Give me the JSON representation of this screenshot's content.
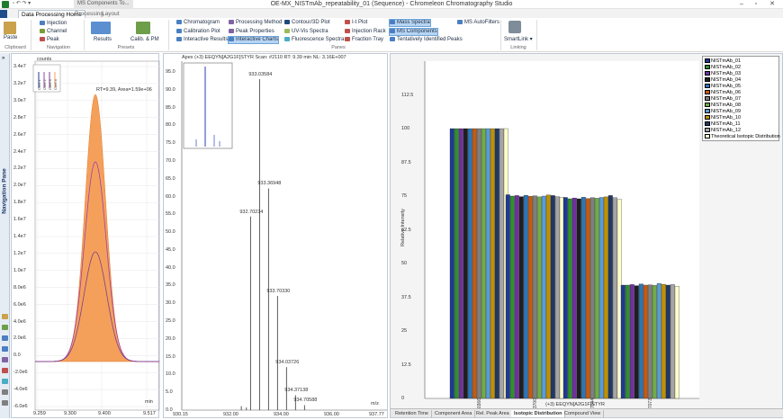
{
  "window": {
    "title": "OE-MX_NISTmAb_repeatability_01 (Sequence) - Chromeleon Chromatography Studio",
    "min": "–",
    "max": "▫",
    "close": "✕"
  },
  "doc_tab": "MS Components To...",
  "tabs": [
    "Data Processing Home",
    "Processing",
    "Layout"
  ],
  "ribbon": {
    "clipboard": {
      "paste": "Paste",
      "label": "Clipboard"
    },
    "navigation": {
      "items": [
        "Injection",
        "Channel",
        "Peak"
      ],
      "label": "Navigation"
    },
    "results": {
      "label": "Results"
    },
    "presets": {
      "calib": "Calib. & PM",
      "label": "Presets"
    },
    "panes": {
      "col1": [
        "Chromatogram",
        "Calibration Plot",
        "Interactive Results"
      ],
      "col2": [
        "Processing Method",
        "Peak Properties",
        "Interactive Charts"
      ],
      "col3": [
        "Contour/3D Plot",
        "UV-Vis Spectra",
        "Fluorescence Spectra"
      ],
      "col4": [
        "I-t Plot",
        "Injection Rack",
        "Fraction Tray"
      ],
      "col5": [
        "Mass Spectra",
        "MS Components",
        "Tentatively Identified Peaks"
      ],
      "col6": [
        "MS AutoFilters"
      ],
      "label": "Panes"
    },
    "linking": {
      "smartlink": "SmartLink",
      "label": "Linking"
    }
  },
  "nav_pane_label": "Navigation Pane",
  "chromatogram": {
    "y_unit": "counts",
    "annotation": "RT=9.39, Area=1.59e+06",
    "x_unit": "min",
    "y_ticks": [
      "3.4e7",
      "3.2e7",
      "3.0e7",
      "2.8e7",
      "2.6e7",
      "2.4e7",
      "2.2e7",
      "2.0e7",
      "1.8e7",
      "1.6e7",
      "1.4e7",
      "1.2e7",
      "1.0e7",
      "8.0e6",
      "6.0e6",
      "4.0e6",
      "2.0e6",
      "0.0",
      "-2.0e6",
      "-4.0e6",
      "-6.0e6"
    ],
    "x_ticks": [
      "9.259",
      "9.300",
      "9.400",
      "9.517"
    ],
    "legend": [
      "Conf 1",
      "Conf 2",
      "Conf 3",
      "Conf 4"
    ]
  },
  "spectrum": {
    "header": "Apex (+3) EEQYN[A2G1F]STYR Scan: #2110  RT: 9.39 min NL: 3.16E+007",
    "y_ticks": [
      "95.0",
      "90.0",
      "85.0",
      "80.0",
      "75.0",
      "70.0",
      "65.0",
      "60.0",
      "55.0",
      "50.0",
      "45.0",
      "40.0",
      "35.0",
      "30.0",
      "25.0",
      "20.0",
      "15.0",
      "10.0",
      "5.0",
      "0.0"
    ],
    "x_ticks": [
      "930.15",
      "932.00",
      "934.00",
      "936.00",
      "937.77"
    ],
    "x_unit": "m/z",
    "peak_labels": [
      "933.03584",
      "933.36948",
      "932.70234",
      "933.70330",
      "934.03726",
      "934.37138",
      "934.70588"
    ]
  },
  "isotopic": {
    "ylabel": "Relative Intensity",
    "xlabel": "(+3) EEQYN[A2G1F]STYR",
    "y_ticks": [
      "112.5",
      "100",
      "87.5",
      "75",
      "62.5",
      "50",
      "37.5",
      "25",
      "12.5",
      "0"
    ],
    "categories": [
      "933.0366",
      "933.3700",
      "932.7044",
      "933.7073"
    ],
    "legend": [
      "NISTmAb_01",
      "NISTmAb_02",
      "NISTmAb_03",
      "NISTmAb_04",
      "NISTmAb_05",
      "NISTmAb_06",
      "NISTmAb_07",
      "NISTmAb_08",
      "NISTmAb_09",
      "NISTmAb_10",
      "NISTmAb_11",
      "NISTmAb_12",
      "Theoretical Isotopic Distribution"
    ],
    "colors": [
      "#1f3a93",
      "#2f8f2f",
      "#7030a0",
      "#1f1f1f",
      "#2e75b6",
      "#c55a11",
      "#7f7f7f",
      "#70ad47",
      "#5b9bd5",
      "#bf9000",
      "#203864",
      "#a5a5a5",
      "#ffffcc"
    ]
  },
  "chart_data": {
    "type": "bar",
    "categories": [
      "933.0366",
      "933.3700",
      "932.7044",
      "933.7073"
    ],
    "series": [
      {
        "name": "NISTmAb_01",
        "values": [
          100,
          75.5,
          74.5,
          42
        ]
      },
      {
        "name": "NISTmAb_02",
        "values": [
          100,
          75,
          74,
          42
        ]
      },
      {
        "name": "NISTmAb_03",
        "values": [
          100,
          75.2,
          74.3,
          42.2
        ]
      },
      {
        "name": "NISTmAb_04",
        "values": [
          100,
          74.8,
          74,
          41.8
        ]
      },
      {
        "name": "NISTmAb_05",
        "values": [
          100,
          75.3,
          74.6,
          42.4
        ]
      },
      {
        "name": "NISTmAb_06",
        "values": [
          100,
          74.9,
          74.1,
          42
        ]
      },
      {
        "name": "NISTmAb_07",
        "values": [
          100,
          75.1,
          74.4,
          42.1
        ]
      },
      {
        "name": "NISTmAb_08",
        "values": [
          100,
          74.7,
          74.2,
          41.9
        ]
      },
      {
        "name": "NISTmAb_09",
        "values": [
          100,
          75,
          74.5,
          42.6
        ]
      },
      {
        "name": "NISTmAb_10",
        "values": [
          100,
          75.4,
          74.7,
          42.3
        ]
      },
      {
        "name": "NISTmAb_11",
        "values": [
          100,
          75.2,
          75.2,
          42
        ]
      },
      {
        "name": "NISTmAb_12",
        "values": [
          100,
          74.8,
          74.4,
          42.2
        ]
      },
      {
        "name": "Theoretical Isotopic Distribution",
        "values": [
          100,
          74.6,
          73.8,
          41.6
        ]
      }
    ],
    "xlabel": "(+3) EEQYN[A2G1F]STYR",
    "ylabel": "Relative Intensity",
    "ylim": [
      0,
      125
    ]
  },
  "bottom_tabs": [
    "Retention Time",
    "Component Area",
    "Rel. Peak Area",
    "Isotopic Distribution",
    "Compound View"
  ],
  "active_bottom_tab": "Isotopic Distribution"
}
